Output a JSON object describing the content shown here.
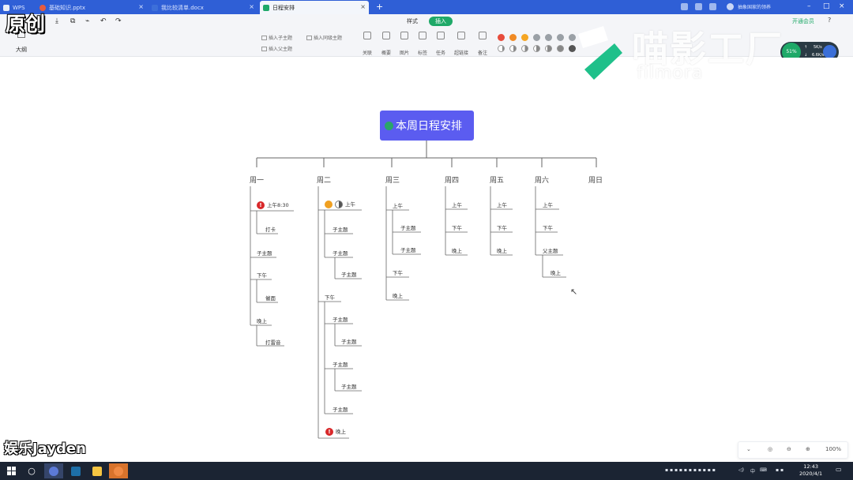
{
  "window": {
    "tabs": [
      {
        "label": "WPS",
        "color": "#e9eef8"
      },
      {
        "label": "基础知识.pptx",
        "color": "#e85b3e"
      },
      {
        "label": "我比较清单.docx",
        "color": "#3d6fd9"
      },
      {
        "label": "日程安排",
        "color": "#1fa968"
      }
    ],
    "new_tab": "+",
    "username": "抽象国家的领养"
  },
  "toolbar": {
    "quick_icons": [
      "下载",
      "导出",
      "格式刷",
      "撤销",
      "重做"
    ],
    "menu_tabs": [
      "样式",
      "插入"
    ],
    "active_menu": "插入",
    "vip": "开通会员",
    "help": "?",
    "outline_label": "大纲",
    "insert_items": [
      "插入子主题",
      "插入同级主题",
      "插入父主题"
    ],
    "tools": [
      "关联",
      "概要",
      "图片",
      "标签",
      "任务",
      "超链接",
      "备注"
    ],
    "marker_colors": [
      "#e74c3c",
      "#f08a24",
      "#f5a623",
      "#9aa0a6",
      "#9aa0a6",
      "#9aa0a6",
      "#9aa0a6"
    ]
  },
  "watermark": {
    "badge": "原创",
    "brand": "喵影工厂",
    "brand_sub": "filmora",
    "creator": "娱乐Jayden"
  },
  "speed_widget": {
    "percent": "51%",
    "up": "5K/s",
    "down": "6.6K/s"
  },
  "mindmap": {
    "root": "本周日程安排",
    "days": [
      {
        "label": "周一",
        "nodes": [
          {
            "text": "上午8:30",
            "marker": "!",
            "marker_color": "#d8282a"
          },
          {
            "text": "打卡"
          },
          {
            "text": "子主题"
          },
          {
            "text": "下午"
          },
          {
            "text": "催面"
          },
          {
            "text": "晚上"
          },
          {
            "text": "打雷音"
          }
        ]
      },
      {
        "label": "周二",
        "nodes": [
          {
            "text": "上午",
            "marker_color": "#f0a020"
          },
          {
            "text": "子主题"
          },
          {
            "text": "子主题"
          },
          {
            "text": "子主题"
          },
          {
            "text": "下午"
          },
          {
            "text": "子主题"
          },
          {
            "text": "子主题"
          },
          {
            "text": "子主题"
          },
          {
            "text": "子主题"
          },
          {
            "text": "子主题"
          },
          {
            "text": "晚上",
            "marker": "!",
            "marker_color": "#d8282a"
          }
        ]
      },
      {
        "label": "周三",
        "nodes": [
          {
            "text": "上午"
          },
          {
            "text": "子主题"
          },
          {
            "text": "子主题"
          },
          {
            "text": "下午"
          },
          {
            "text": "晚上"
          }
        ]
      },
      {
        "label": "周四",
        "nodes": [
          {
            "text": "上午"
          },
          {
            "text": "下午"
          },
          {
            "text": "晚上"
          }
        ]
      },
      {
        "label": "周五",
        "nodes": [
          {
            "text": "上午"
          },
          {
            "text": "下午"
          },
          {
            "text": "晚上"
          }
        ]
      },
      {
        "label": "周六",
        "nodes": [
          {
            "text": "上午"
          },
          {
            "text": "下午"
          },
          {
            "text": "父主题"
          },
          {
            "text": "晚上"
          }
        ]
      },
      {
        "label": "周日",
        "nodes": []
      }
    ]
  },
  "zoom": {
    "value": "100%"
  },
  "taskbar": {
    "tray_lang": "中",
    "time": "12:43",
    "date": "2020/4/1"
  }
}
